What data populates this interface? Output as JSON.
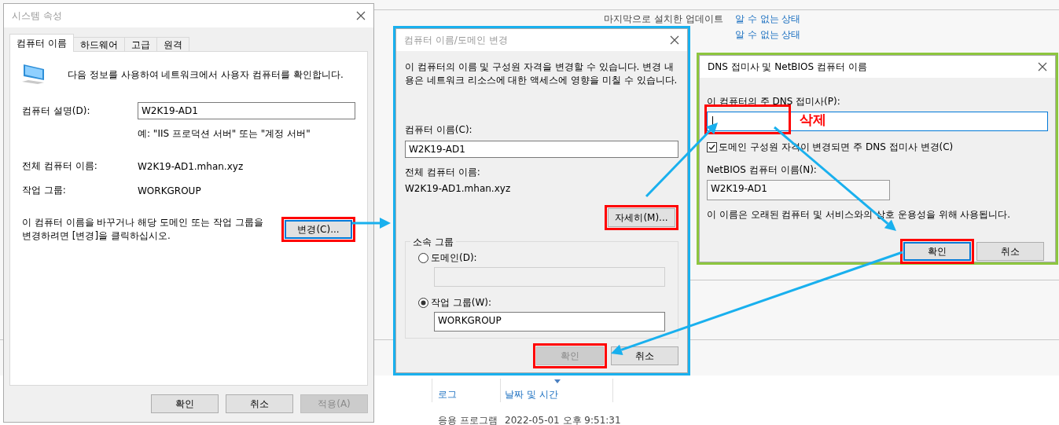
{
  "background": {
    "update_label": "마지막으로 설치한 업데이트",
    "update_statuses": [
      "알 수 없는 상태",
      "알 수 없는 상태"
    ],
    "log_columns": [
      "로그",
      "날짜 및 시간"
    ],
    "log_row": [
      "응용 프로그램",
      "2022-05-01 오후 9:51:31"
    ]
  },
  "system_properties": {
    "title": "시스템 속성",
    "tabs": [
      {
        "label": "컴퓨터 이름",
        "selected": true
      },
      {
        "label": "하드웨어",
        "selected": false
      },
      {
        "label": "고급",
        "selected": false
      },
      {
        "label": "원격",
        "selected": false
      }
    ],
    "intro": "다음 정보를 사용하여 네트워크에서 사용자 컴퓨터를 확인합니다.",
    "description": {
      "label": "컴퓨터 설명(D):",
      "value": "W2K19-AD1",
      "hint": "예: \"IIS 프로덕션 서버\" 또는 \"계정 서버\""
    },
    "full_name": {
      "label": "전체 컴퓨터 이름:",
      "value": "W2K19-AD1.mhan.xyz"
    },
    "workgroup": {
      "label": "작업 그룹:",
      "value": "WORKGROUP"
    },
    "change_note": "이 컴퓨터 이름을 바꾸거나 해당 도메인 또는 작업 그룹을 변경하려면 [변경]을 클릭하십시오.",
    "change_button": {
      "label": "변경(C)...",
      "disabled": false,
      "focused": true,
      "highlighted": true
    },
    "buttons": [
      {
        "label": "확인",
        "disabled": false,
        "focused": false,
        "highlighted": false
      },
      {
        "label": "취소",
        "disabled": false,
        "focused": false,
        "highlighted": false
      },
      {
        "label": "적용(A)",
        "disabled": true,
        "focused": false,
        "highlighted": false
      }
    ]
  },
  "change_dialog": {
    "title": "컴퓨터 이름/도메인 변경",
    "intro": "이 컴퓨터의 이름 및 구성원 자격을 변경할 수 있습니다. 변경 내용은 네트워크 리소스에 대한 액세스에 영향을 미칠 수 있습니다.",
    "name_label": "컴퓨터 이름(C):",
    "name_value": "W2K19-AD1",
    "full_name_label": "전체 컴퓨터 이름:",
    "full_name_value": "W2K19-AD1.mhan.xyz",
    "more_button": {
      "label": "자세히(M)...",
      "disabled": false,
      "focused": false,
      "highlighted": true
    },
    "group_title": "소속 그룹",
    "options": [
      {
        "label": "도메인(D):",
        "selected": false,
        "field_disabled": true
      },
      {
        "label": "작업 그룹(W):",
        "selected": true,
        "field_disabled": false,
        "value": "WORKGROUP"
      }
    ],
    "buttons": [
      {
        "label": "확인",
        "disabled": true,
        "focused": false,
        "highlighted": true
      },
      {
        "label": "취소",
        "disabled": false,
        "focused": false,
        "highlighted": false
      }
    ]
  },
  "dns_dialog": {
    "title": "DNS 접미사 및 NetBIOS 컴퓨터 이름",
    "suffix_label": "이 컴퓨터의 주 DNS 접미사(P):",
    "suffix_focused": true,
    "suffix_highlighted": true,
    "suffix_note": "삭제",
    "checkbox": {
      "label": "도메인 구성원 자격이 변경되면 주 DNS 접미사 변경(C)",
      "checked": true
    },
    "netbios_label": "NetBIOS 컴퓨터 이름(N):",
    "netbios_value": "W2K19-AD1",
    "note": "이 이름은 오래된 컴퓨터 및 서비스와의 상호 운용성을 위해 사용됩니다.",
    "buttons": [
      {
        "label": "확인",
        "disabled": false,
        "focused": true,
        "highlighted": true
      },
      {
        "label": "취소",
        "disabled": false,
        "focused": false,
        "highlighted": false
      }
    ]
  }
}
